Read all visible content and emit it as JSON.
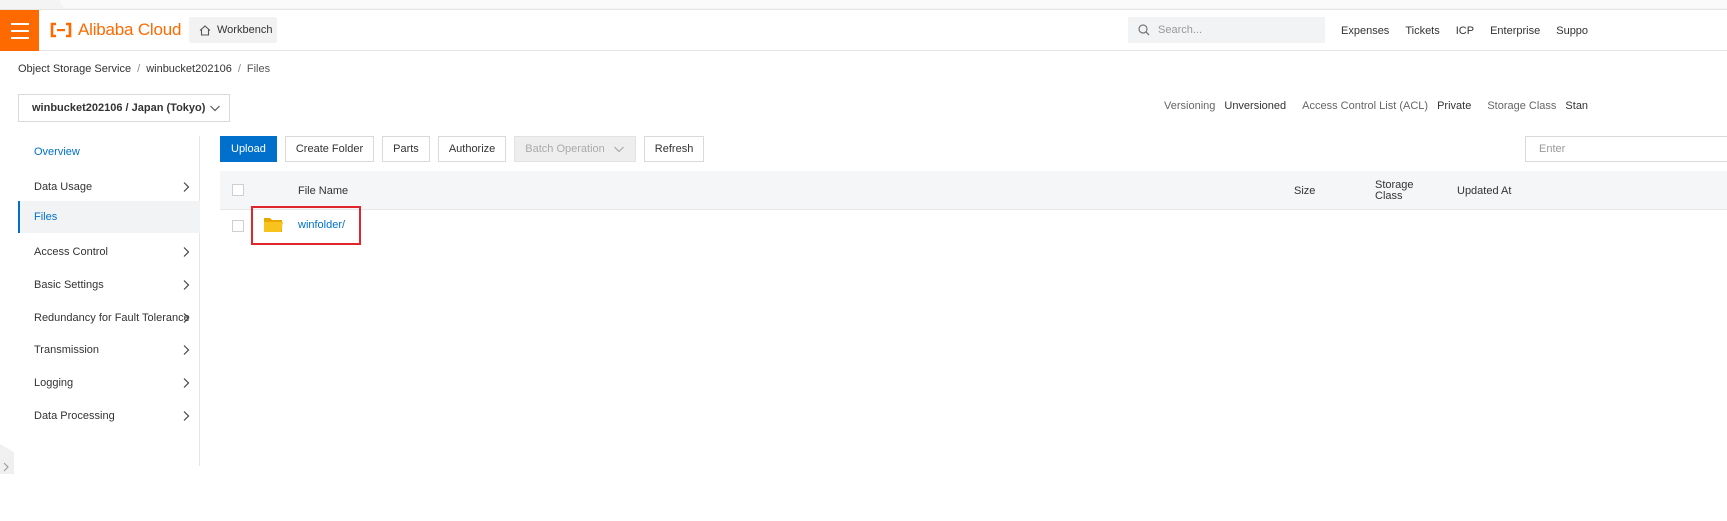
{
  "navbar": {
    "brand": "Alibaba Cloud",
    "workbench_label": "Workbench",
    "search_placeholder": "Search...",
    "menu": [
      "Expenses",
      "Tickets",
      "ICP",
      "Enterprise",
      "Suppo"
    ]
  },
  "breadcrumb": [
    "Object Storage Service",
    "winbucket202106",
    "Files"
  ],
  "bucket_selector": {
    "value": "winbucket202106 / Japan (Tokyo)"
  },
  "bucket_meta": [
    {
      "label": "Versioning",
      "value": "Unversioned"
    },
    {
      "label": "Access Control List (ACL)",
      "value": "Private"
    },
    {
      "label": "Storage Class",
      "value": "Stan"
    }
  ],
  "sidebar": {
    "items": [
      {
        "label": "Overview",
        "state": "link",
        "has_arrow": false
      },
      {
        "label": "Data Usage",
        "state": "normal",
        "has_arrow": true
      },
      {
        "label": "Files",
        "state": "active",
        "has_arrow": false
      },
      {
        "label": "Access Control",
        "state": "normal",
        "has_arrow": true
      },
      {
        "label": "Basic Settings",
        "state": "normal",
        "has_arrow": true
      },
      {
        "label": "Redundancy for Fault Tolerance",
        "state": "normal",
        "has_arrow": true
      },
      {
        "label": "Transmission",
        "state": "normal",
        "has_arrow": true
      },
      {
        "label": "Logging",
        "state": "normal",
        "has_arrow": true
      },
      {
        "label": "Data Processing",
        "state": "normal",
        "has_arrow": true
      }
    ]
  },
  "toolbar": {
    "upload": "Upload",
    "create_folder": "Create Folder",
    "parts": "Parts",
    "authorize": "Authorize",
    "batch_operation": "Batch Operation",
    "refresh": "Refresh",
    "filter_placeholder": "Enter"
  },
  "table": {
    "columns": {
      "file_name": "File Name",
      "size": "Size",
      "storage_class_line1": "Storage",
      "storage_class_line2": "Class",
      "updated_at": "Updated At"
    },
    "rows": [
      {
        "name": "winfolder/",
        "type": "folder",
        "highlighted": true
      }
    ]
  },
  "colors": {
    "brand_orange": "#ff6a00",
    "primary_blue": "#0070cc",
    "highlight_red": "#e0262b",
    "folder_yellow": "#f8c31d"
  }
}
